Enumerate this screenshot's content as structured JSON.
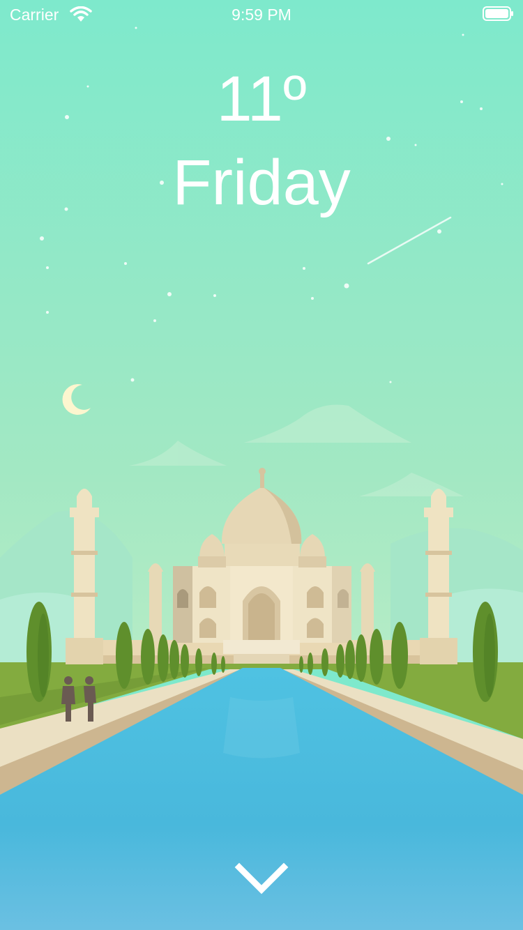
{
  "status_bar": {
    "carrier": "Carrier",
    "time": "9:59 PM"
  },
  "weather": {
    "temperature": "11º",
    "day": "Friday"
  },
  "icons": {
    "wifi": "wifi-icon",
    "battery": "battery-icon",
    "expand": "chevron-down-icon",
    "moon": "crescent-moon-icon"
  },
  "colors": {
    "sky_top": "#7ee9cc",
    "sky_bottom": "#a3e9c0",
    "water": "#4cbfe0",
    "grass": "#7ea63a",
    "marble": "#efe4c4",
    "text": "#ffffff"
  }
}
